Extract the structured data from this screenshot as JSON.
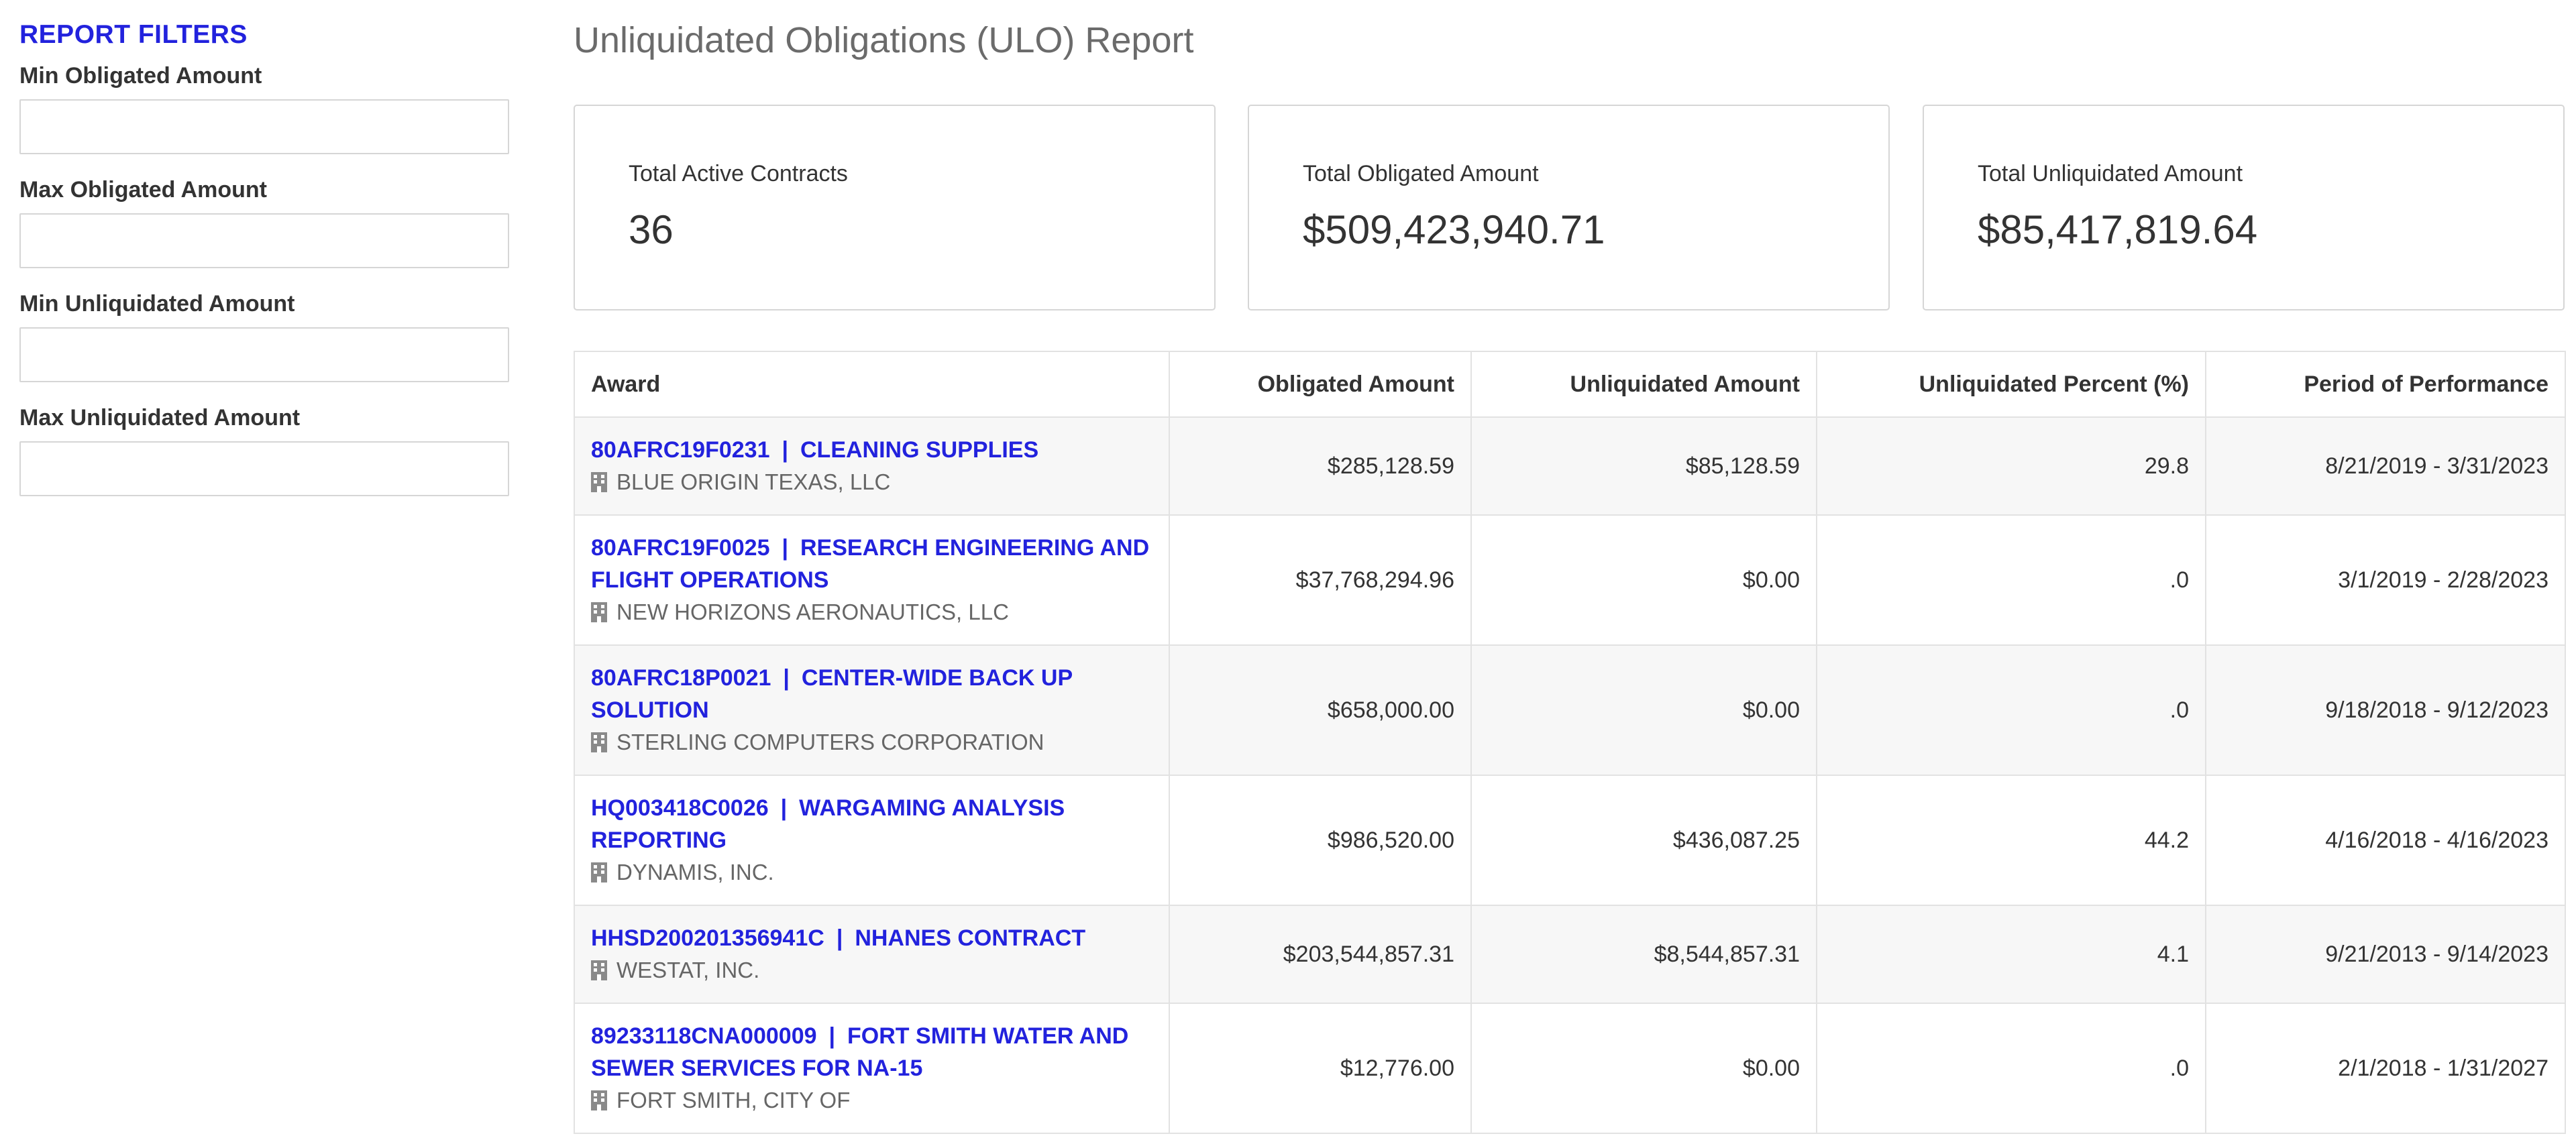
{
  "filters": {
    "title": "REPORT FILTERS",
    "fields": [
      {
        "label": "Min Obligated Amount",
        "value": "",
        "placeholder": ""
      },
      {
        "label": "Max Obligated Amount",
        "value": "",
        "placeholder": ""
      },
      {
        "label": "Min Unliquidated Amount",
        "value": "",
        "placeholder": ""
      },
      {
        "label": "Max Unliquidated Amount",
        "value": "",
        "placeholder": ""
      }
    ]
  },
  "page": {
    "title": "Unliquidated Obligations (ULO) Report"
  },
  "summary": [
    {
      "label": "Total Active Contracts",
      "value": "36"
    },
    {
      "label": "Total Obligated Amount",
      "value": "$509,423,940.71"
    },
    {
      "label": "Total Unliquidated Amount",
      "value": "$85,417,819.64"
    }
  ],
  "table": {
    "headers": {
      "award": "Award",
      "obligated": "Obligated Amount",
      "unliquidated": "Unliquidated Amount",
      "percent": "Unliquidated Percent (%)",
      "period": "Period of Performance"
    },
    "separator": "|",
    "rows": [
      {
        "award_id": "80AFRC19F0231",
        "award_title": "CLEANING SUPPLIES",
        "vendor": "BLUE ORIGIN TEXAS, LLC",
        "obligated": "$285,128.59",
        "unliquidated": "$85,128.59",
        "percent": "29.8",
        "period": "8/21/2019 - 3/31/2023"
      },
      {
        "award_id": "80AFRC19F0025",
        "award_title": "RESEARCH ENGINEERING AND FLIGHT OPERATIONS",
        "vendor": "NEW HORIZONS AERONAUTICS, LLC",
        "obligated": "$37,768,294.96",
        "unliquidated": "$0.00",
        "percent": ".0",
        "period": "3/1/2019 - 2/28/2023"
      },
      {
        "award_id": "80AFRC18P0021",
        "award_title": "CENTER-WIDE BACK UP SOLUTION",
        "vendor": "STERLING COMPUTERS CORPORATION",
        "obligated": "$658,000.00",
        "unliquidated": "$0.00",
        "percent": ".0",
        "period": "9/18/2018 - 9/12/2023"
      },
      {
        "award_id": "HQ003418C0026",
        "award_title": "WARGAMING ANALYSIS REPORTING",
        "vendor": "DYNAMIS, INC.",
        "obligated": "$986,520.00",
        "unliquidated": "$436,087.25",
        "percent": "44.2",
        "period": "4/16/2018 - 4/16/2023"
      },
      {
        "award_id": "HHSD200201356941C",
        "award_title": "NHANES CONTRACT",
        "vendor": "WESTAT, INC.",
        "obligated": "$203,544,857.31",
        "unliquidated": "$8,544,857.31",
        "percent": "4.1",
        "period": "9/21/2013 - 9/14/2023"
      },
      {
        "award_id": "89233118CNA000009",
        "award_title": "FORT SMITH WATER AND SEWER SERVICES FOR NA-15",
        "vendor": "FORT SMITH, CITY OF",
        "obligated": "$12,776.00",
        "unliquidated": "$0.00",
        "percent": ".0",
        "period": "2/1/2018 - 1/31/2027"
      }
    ]
  },
  "colors": {
    "accent": "#2222dd",
    "title_gray": "#6b6b6b",
    "border": "#d6d6d6",
    "row_stripe": "#f7f7f7"
  }
}
